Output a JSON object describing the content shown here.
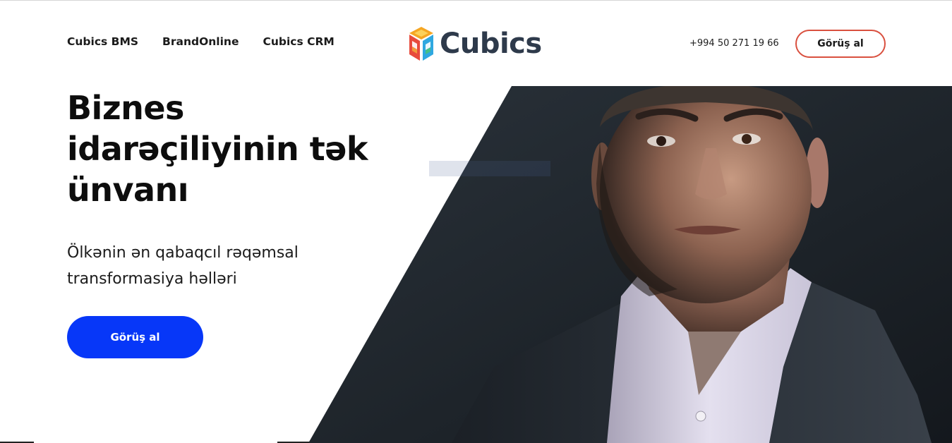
{
  "header": {
    "nav": [
      {
        "label": "Cubics BMS"
      },
      {
        "label": "BrandOnline"
      },
      {
        "label": "Cubics CRM"
      }
    ],
    "logo_text": "Cubics",
    "phone": "+994 50 271 19 66",
    "cta_label": "Görüş al"
  },
  "hero": {
    "title": "Biznes idarəçiliyinin tək ünvanı",
    "subtitle": "Ölkənin ən qabaqcıl rəqəmsal transformasiya həlləri",
    "cta_label": "Görüş al",
    "image_icon": "portrait-photo"
  },
  "colors": {
    "primary_button": "#0737f8",
    "outline_button_border": "#d9503f",
    "logo_text": "#2e3a4b",
    "photo_background": "#1e242b"
  }
}
